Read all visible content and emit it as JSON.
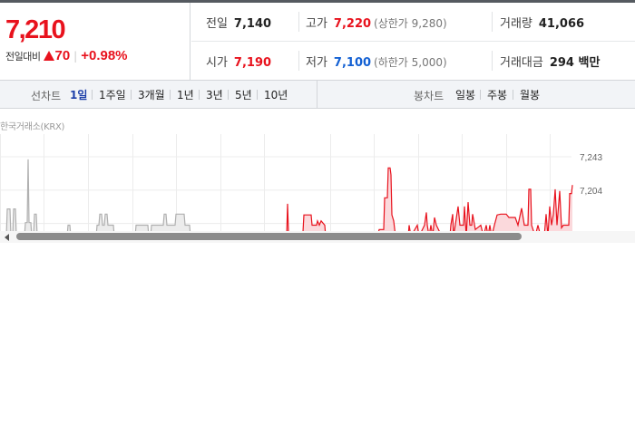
{
  "quote": {
    "price": "7,210",
    "change_label": "전일대비",
    "change_abs": "70",
    "change_pct": "+0.98%",
    "colors": {
      "up": "#e8121d",
      "down": "#1360d3"
    }
  },
  "stats": {
    "prev_close": {
      "label": "전일",
      "value": "7,140"
    },
    "high": {
      "label": "고가",
      "value": "7,220",
      "sub": "(상한가 9,280)"
    },
    "volume": {
      "label": "거래량",
      "value": "41,066"
    },
    "open": {
      "label": "시가",
      "value": "7,190"
    },
    "low": {
      "label": "저가",
      "value": "7,100",
      "sub": "(하한가 5,000)"
    },
    "trade_value": {
      "label": "거래대금",
      "value": "294 백만"
    }
  },
  "line_chart_tabs": {
    "title": "선차트",
    "items": [
      "1일",
      "1주일",
      "3개월",
      "1년",
      "3년",
      "5년",
      "10년"
    ],
    "active_index": 0
  },
  "candle_chart_tabs": {
    "title": "봉차트",
    "items": [
      "일봉",
      "주봉",
      "월봉"
    ]
  },
  "chart_source": "한국거래소(KRX)",
  "chart_data": {
    "type": "area",
    "y_ticks": [
      "7,243",
      "7,204"
    ],
    "ylim": [
      7100,
      7260
    ],
    "grid": true,
    "colors": {
      "pre": "#b0b0b0",
      "pre_fill": "#ececec",
      "main": "#e8121d",
      "main_fill": "#fbd9dc"
    },
    "points": [
      [
        0,
        7150
      ],
      [
        7,
        7150
      ],
      [
        8,
        7182
      ],
      [
        11,
        7182
      ],
      [
        12,
        7150
      ],
      [
        14,
        7150
      ],
      [
        15,
        7182
      ],
      [
        17,
        7182
      ],
      [
        18,
        7150
      ],
      [
        27,
        7150
      ],
      [
        28,
        7166
      ],
      [
        30,
        7166
      ],
      [
        31,
        7240
      ],
      [
        32,
        7166
      ],
      [
        34,
        7166
      ],
      [
        35,
        7150
      ],
      [
        37,
        7150
      ],
      [
        38,
        7176
      ],
      [
        40,
        7176
      ],
      [
        41,
        7150
      ],
      [
        74,
        7150
      ],
      [
        75,
        7163
      ],
      [
        77,
        7163
      ],
      [
        78,
        7150
      ],
      [
        106,
        7150
      ],
      [
        107,
        7163
      ],
      [
        109,
        7163
      ],
      [
        110,
        7176
      ],
      [
        112,
        7176
      ],
      [
        113,
        7163
      ],
      [
        115,
        7163
      ],
      [
        116,
        7176
      ],
      [
        118,
        7176
      ],
      [
        119,
        7163
      ],
      [
        125,
        7163
      ],
      [
        126,
        7150
      ],
      [
        149,
        7150
      ],
      [
        150,
        7163
      ],
      [
        163,
        7163
      ],
      [
        164,
        7150
      ],
      [
        166,
        7150
      ],
      [
        167,
        7163
      ],
      [
        180,
        7163
      ],
      [
        181,
        7176
      ],
      [
        183,
        7176
      ],
      [
        184,
        7163
      ],
      [
        193,
        7163
      ],
      [
        194,
        7176
      ],
      [
        203,
        7176
      ],
      [
        204,
        7163
      ],
      [
        209,
        7163
      ],
      [
        210,
        7150
      ],
      [
        316,
        7150
      ],
      [
        317,
        7188
      ],
      [
        318,
        7155
      ],
      [
        330,
        7155
      ],
      [
        334,
        7155
      ],
      [
        335,
        7175
      ],
      [
        343,
        7175
      ],
      [
        344,
        7163
      ],
      [
        349,
        7163
      ],
      [
        350,
        7168
      ],
      [
        352,
        7163
      ],
      [
        354,
        7168
      ],
      [
        358,
        7163
      ],
      [
        359,
        7150
      ],
      [
        416,
        7150
      ],
      [
        418,
        7158
      ],
      [
        423,
        7158
      ],
      [
        424,
        7195
      ],
      [
        427,
        7195
      ],
      [
        428,
        7230
      ],
      [
        430,
        7230
      ],
      [
        431,
        7222
      ],
      [
        432,
        7175
      ],
      [
        434,
        7168
      ],
      [
        436,
        7150
      ],
      [
        450,
        7150
      ],
      [
        451,
        7163
      ],
      [
        453,
        7150
      ],
      [
        460,
        7163
      ],
      [
        462,
        7150
      ],
      [
        468,
        7163
      ],
      [
        470,
        7178
      ],
      [
        471,
        7163
      ],
      [
        473,
        7150
      ],
      [
        475,
        7163
      ],
      [
        477,
        7150
      ],
      [
        479,
        7172
      ],
      [
        481,
        7163
      ],
      [
        487,
        7150
      ],
      [
        496,
        7150
      ],
      [
        497,
        7163
      ],
      [
        499,
        7176
      ],
      [
        500,
        7150
      ],
      [
        505,
        7185
      ],
      [
        507,
        7163
      ],
      [
        511,
        7163
      ],
      [
        512,
        7185
      ],
      [
        514,
        7150
      ],
      [
        516,
        7190
      ],
      [
        518,
        7163
      ],
      [
        520,
        7163
      ],
      [
        521,
        7176
      ],
      [
        524,
        7158
      ],
      [
        530,
        7163
      ],
      [
        533,
        7150
      ],
      [
        536,
        7163
      ],
      [
        538,
        7150
      ],
      [
        540,
        7163
      ],
      [
        542,
        7150
      ],
      [
        545,
        7163
      ],
      [
        548,
        7175
      ],
      [
        552,
        7176
      ],
      [
        558,
        7176
      ],
      [
        561,
        7172
      ],
      [
        568,
        7172
      ],
      [
        571,
        7163
      ],
      [
        575,
        7183
      ],
      [
        578,
        7163
      ],
      [
        582,
        7163
      ],
      [
        583,
        7205
      ],
      [
        585,
        7205
      ],
      [
        586,
        7163
      ],
      [
        590,
        7150
      ],
      [
        593,
        7163
      ],
      [
        596,
        7150
      ],
      [
        600,
        7150
      ],
      [
        602,
        7176
      ],
      [
        604,
        7150
      ],
      [
        606,
        7185
      ],
      [
        608,
        7163
      ],
      [
        610,
        7176
      ],
      [
        612,
        7205
      ],
      [
        614,
        7163
      ],
      [
        617,
        7203
      ],
      [
        619,
        7160
      ],
      [
        621,
        7163
      ],
      [
        627,
        7163
      ],
      [
        628,
        7200
      ],
      [
        630,
        7200
      ],
      [
        631,
        7210
      ]
    ],
    "split_x": 300
  }
}
